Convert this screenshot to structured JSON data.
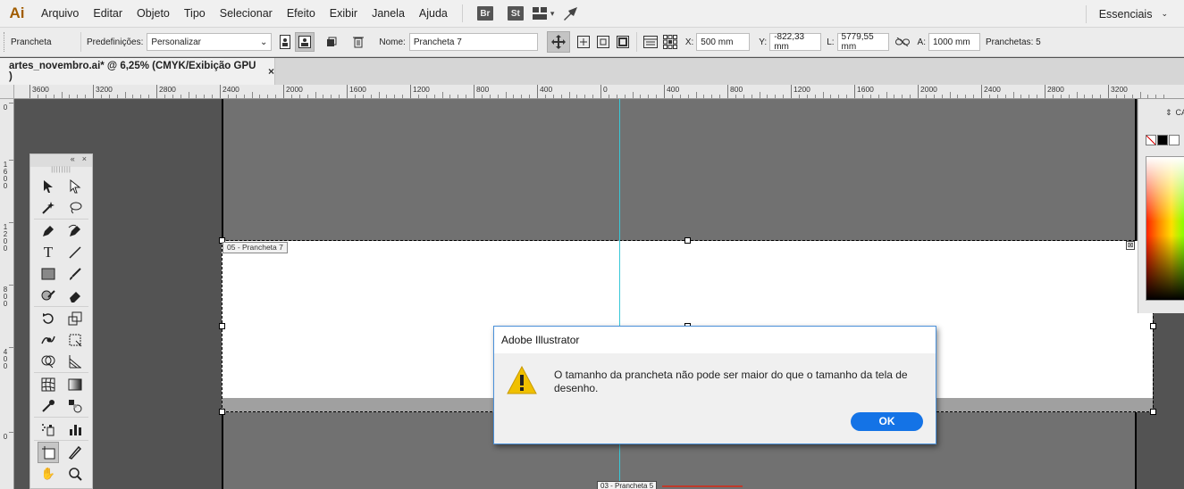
{
  "menubar": {
    "logo": "Ai",
    "items": [
      "Arquivo",
      "Editar",
      "Objeto",
      "Tipo",
      "Selecionar",
      "Efeito",
      "Exibir",
      "Janela",
      "Ajuda"
    ],
    "badges": [
      "Br",
      "St"
    ],
    "workspace": "Essenciais"
  },
  "controlbar": {
    "tool_name": "Prancheta",
    "presets_label": "Predefinições:",
    "presets_value": "Personalizar",
    "name_label": "Nome:",
    "name_value": "Prancheta 7",
    "x_label": "X:",
    "x_value": "500 mm",
    "y_label": "Y:",
    "y_value": "-822,33 mm",
    "w_label": "L:",
    "w_value": "5779,55 mm",
    "h_label": "A:",
    "h_value": "1000 mm",
    "artboards_label": "Pranchetas: 5"
  },
  "document": {
    "tab_title": "artes_novembro.ai* @ 6,25% (CMYK/Exibição GPU )",
    "close": "×"
  },
  "rulers": {
    "h_labels": [
      "3600",
      "3200",
      "2800",
      "2400",
      "2000",
      "1600",
      "1200",
      "800",
      "400",
      "0",
      "400",
      "800",
      "1200",
      "1600",
      "2000",
      "2400",
      "2800",
      "3200"
    ],
    "v_labels": [
      "0",
      "1600",
      "1200",
      "800",
      "400",
      "0"
    ]
  },
  "canvas": {
    "artboard_label": "05 - Prancheta 7",
    "artboard3_label": "03 - Prancheta 5",
    "artboard_close": "⊠"
  },
  "right_panel": {
    "header": "CA"
  },
  "dialog": {
    "title": "Adobe Illustrator",
    "message": "O tamanho da prancheta não pode ser maior do que o tamanho da tela de desenho.",
    "ok_label": "OK"
  },
  "colors": {
    "accent": "#1473e6",
    "guide": "#37c8d8",
    "warning": "#f0c000"
  }
}
